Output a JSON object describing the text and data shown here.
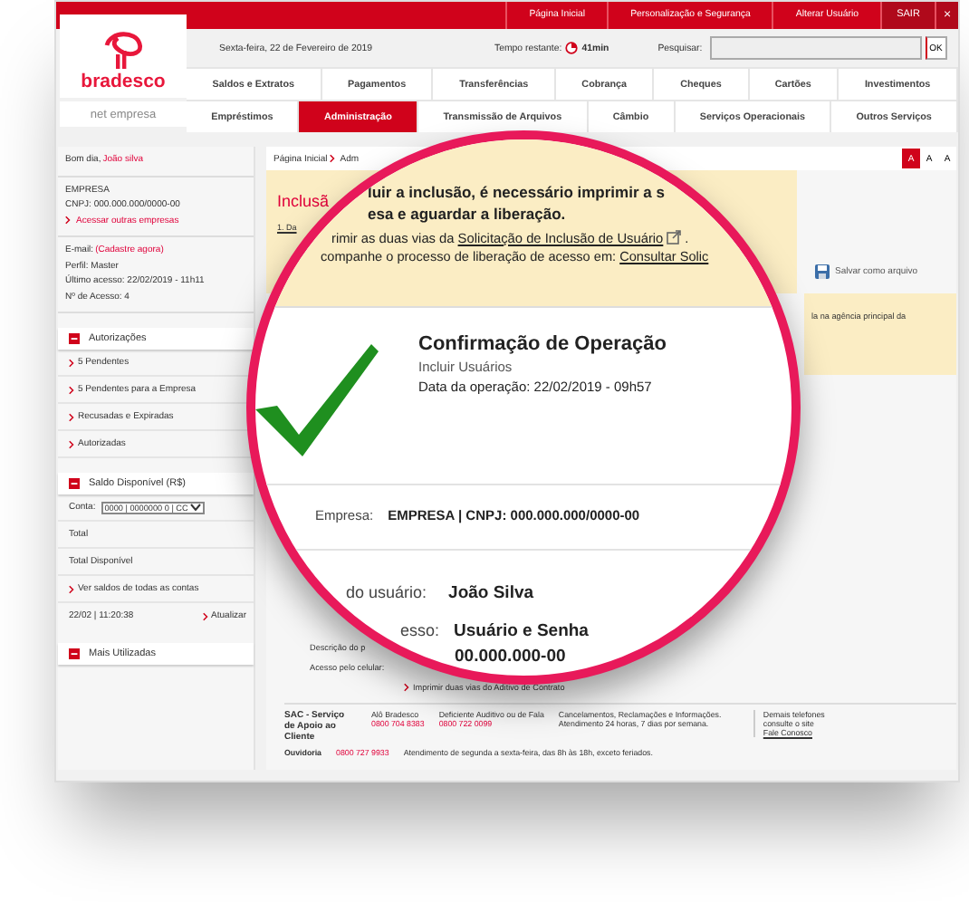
{
  "top_bar": {
    "links": [
      "Página Inicial",
      "Personalização e Segurança",
      "Alterar Usuário"
    ],
    "logout": "SAIR",
    "close": "×"
  },
  "logo": {
    "brand": "bradesco",
    "product": "net empresa"
  },
  "info_bar": {
    "date": "Sexta-feira, 22 de Fevereiro de 2019",
    "timer_label": "Tempo restante:",
    "timer": "41min",
    "search_label": "Pesquisar:",
    "search_button": "OK"
  },
  "nav": [
    [
      {
        "label": "Saldos e Extratos",
        "selected": false
      },
      {
        "label": "Pagamentos",
        "selected": false
      },
      {
        "label": "Transferências",
        "selected": false
      },
      {
        "label": "Cobrança",
        "selected": false
      },
      {
        "label": "Cheques",
        "selected": false
      },
      {
        "label": "Cartões",
        "selected": false
      },
      {
        "label": "Investimentos",
        "selected": false
      }
    ],
    [
      {
        "label": "Empréstimos",
        "selected": false
      },
      {
        "label": "Administração",
        "selected": true
      },
      {
        "label": "Transmissão de Arquivos",
        "selected": false
      },
      {
        "label": "Câmbio",
        "selected": false
      },
      {
        "label": "Serviços Operacionais",
        "selected": false
      },
      {
        "label": "Outros Serviços",
        "selected": false
      }
    ]
  ],
  "sidebar": {
    "greeting": "Bom dia,",
    "user": "João silva",
    "company": "EMPRESA",
    "cnpj": "CNPJ: 000.000.000/0000-00",
    "switch_link": "Acessar outras empresas",
    "email_label": "E-mail:",
    "email_link": "(Cadastre agora)",
    "details": [
      "Perfil: Master",
      "Último acesso: 22/02/2019 - 11h11",
      "Nº de Acesso: 4"
    ],
    "sections": [
      {
        "kind": "links",
        "title": "Autorizações",
        "items": [
          "5 Pendentes",
          "5 Pendentes para a Empresa",
          "Recusadas e Expiradas",
          "Autorizadas"
        ]
      },
      {
        "kind": "balance",
        "title": "Saldo Disponível (R$)",
        "account_label": "Conta:",
        "account": "0000 | 0000000 0 | CC",
        "rows": [
          "Total",
          "Total Disponível"
        ],
        "all_link": "Ver saldos de todas as contas",
        "updated": "22/02 | 11:20:38",
        "refresh_link": "Atualizar"
      },
      {
        "kind": "collapsed",
        "title": "Mais Utilizadas"
      }
    ]
  },
  "main": {
    "breadcrumb": [
      "Página Inicial",
      "Adm"
    ],
    "font_sizes": [
      {
        "label": "A",
        "selected": true
      },
      {
        "label": "A",
        "selected": false
      },
      {
        "label": "A",
        "selected": false
      }
    ],
    "title": "Inclusã",
    "step": "1. Da",
    "save": "Salvar como arquivo",
    "note": "la na agência principal da",
    "details": [
      "Descrição do p",
      "Acesso pelo celular:"
    ],
    "print_link": "Imprimir duas vias do Aditivo de Contrato"
  },
  "magnifier": {
    "notice": [
      "luir a inclusão, é necessário imprimir a s",
      "esa e aguardar a liberação."
    ],
    "print_prefix": "rimir as duas vias da",
    "print_link": "Solicitação de Inclusão de Usuário",
    "print_suffix": ".",
    "follow_prefix": "companhe o processo de liberação de acesso em:",
    "follow_link": "Consultar Solic",
    "confirmation": {
      "title": "Confirmação de Operação",
      "operation": "Incluir Usuários",
      "date": "Data da operação: 22/02/2019 - 09h57"
    },
    "company_label": "Empresa:",
    "company": "EMPRESA | CNPJ: 000.000.000/0000-00",
    "fields": [
      {
        "label": "do usuário:",
        "value": "João Silva"
      },
      {
        "label": "esso:",
        "value": "Usuário e Senha"
      }
    ],
    "phone": "00.000.000-00"
  },
  "footer": {
    "sac": "SAC - Serviço de Apoio ao Cliente",
    "phones": [
      {
        "label": "Alô Bradesco",
        "number": "0800 704 8383"
      },
      {
        "label": "Deficiente Auditivo ou de Fala",
        "number": "0800 722 0099"
      }
    ],
    "hours": "Cancelamentos, Reclamações e Informações. Atendimento 24 horas, 7 dias por semana.",
    "other": "Demais telefones consulte o site",
    "contact_link": "Fale Conosco",
    "ombudsman": {
      "label": "Ouvidoria",
      "number": "0800 727 9933",
      "hours": "Atendimento de segunda a sexta-feira, das 8h às 18h, exceto feriados."
    }
  }
}
